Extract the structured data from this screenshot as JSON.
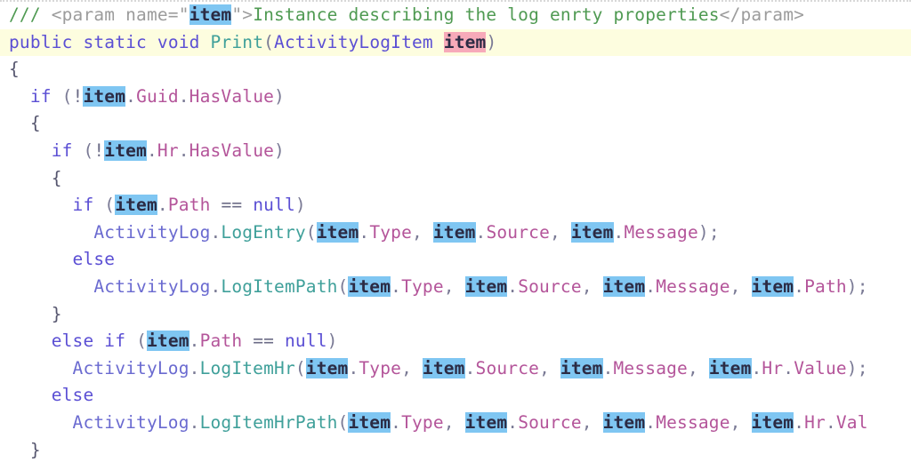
{
  "editor": {
    "language": "csharp",
    "background_color": "#ffffff",
    "current_line_highlight_color": "#fdfddf",
    "symbol_highlight_color": "#7fc6f2",
    "definition_highlight_color": "#f7aab9",
    "font_size_px": 19.5
  },
  "colors": {
    "keyword": "#5b4fd4",
    "type": "#5b4fd4",
    "method": "#3fa09a",
    "class": "#6a6ad0",
    "property": "#b4559a",
    "comment": "#4f9a52",
    "xml_tag": "#9c9c9c",
    "punctuation": "#7a7a95",
    "plain": "#3b3b4f"
  },
  "code": {
    "lines": [
      {
        "index": 1,
        "highlighted": false,
        "text": "/// <param name=\"item\">Instance describing the log enrty properties</param>"
      },
      {
        "index": 2,
        "highlighted": true,
        "text": "public static void Print(ActivityLogItem item)"
      },
      {
        "index": 3,
        "highlighted": false,
        "text": "{"
      },
      {
        "index": 4,
        "highlighted": false,
        "text": "  if (!item.Guid.HasValue)"
      },
      {
        "index": 5,
        "highlighted": false,
        "text": "  {"
      },
      {
        "index": 6,
        "highlighted": false,
        "text": "    if (!item.Hr.HasValue)"
      },
      {
        "index": 7,
        "highlighted": false,
        "text": "    {"
      },
      {
        "index": 8,
        "highlighted": false,
        "text": "      if (item.Path == null)"
      },
      {
        "index": 9,
        "highlighted": false,
        "text": "        ActivityLog.LogEntry(item.Type, item.Source, item.Message);"
      },
      {
        "index": 10,
        "highlighted": false,
        "text": "      else"
      },
      {
        "index": 11,
        "highlighted": false,
        "text": "        ActivityLog.LogItemPath(item.Type, item.Source, item.Message, item.Path);"
      },
      {
        "index": 12,
        "highlighted": false,
        "text": "    }"
      },
      {
        "index": 13,
        "highlighted": false,
        "text": "    else if (item.Path == null)"
      },
      {
        "index": 14,
        "highlighted": false,
        "text": "      ActivityLog.LogItemHr(item.Type, item.Source, item.Message, item.Hr.Value);"
      },
      {
        "index": 15,
        "highlighted": false,
        "text": "    else"
      },
      {
        "index": 16,
        "highlighted": false,
        "text": "      ActivityLog.LogItemHrPath(item.Type, item.Source, item.Message, item.Hr.Val"
      },
      {
        "index": 17,
        "highlighted": false,
        "text": "  }"
      }
    ],
    "tokens": {
      "comment_slashes": "///",
      "xml_open": "<param name=",
      "xml_quote": "\"",
      "xml_param_name": "item",
      "xml_close_bracket": ">",
      "comment_body": "Instance describing the log enrty properties",
      "xml_end_tag": "</param>",
      "kw_public": "public",
      "kw_static": "static",
      "kw_void": "void",
      "method_print": "Print",
      "type_activitylogitem": "ActivityLogItem",
      "param_item": "item",
      "kw_if": "if",
      "kw_else": "else",
      "kw_null": "null",
      "op_not": "!",
      "op_eq": "==",
      "var_item": "item",
      "class_activitylog": "ActivityLog",
      "prop_guid": "Guid",
      "prop_hr": "Hr",
      "prop_hasvalue": "HasValue",
      "prop_path": "Path",
      "prop_type": "Type",
      "prop_source": "Source",
      "prop_message": "Message",
      "prop_value": "Value",
      "prop_val_truncated": "Val",
      "m_logentry": "LogEntry",
      "m_logitempath": "LogItemPath",
      "m_logitemhr": "LogItemHr",
      "m_logitemhrpath": "LogItemHrPath",
      "brace_open": "{",
      "brace_close": "}",
      "paren_open": "(",
      "paren_close": ")",
      "semicolon": ";",
      "comma": ",",
      "dot": "."
    }
  }
}
